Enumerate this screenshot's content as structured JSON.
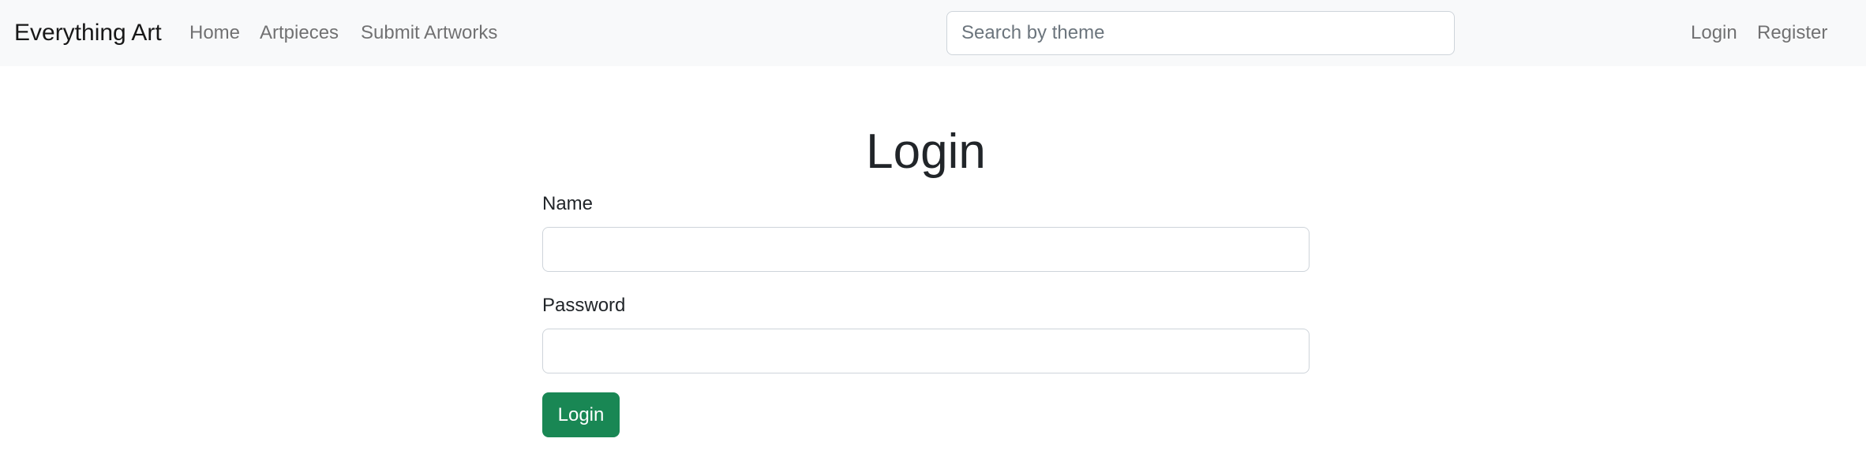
{
  "navbar": {
    "brand": "Everything Art",
    "links": [
      {
        "label": "Home"
      },
      {
        "label": "Artpieces"
      },
      {
        "label": "Submit Artworks"
      }
    ],
    "search": {
      "placeholder": "Search by theme",
      "value": ""
    },
    "auth_links": [
      {
        "label": "Login"
      },
      {
        "label": "Register"
      }
    ]
  },
  "main": {
    "title": "Login",
    "fields": [
      {
        "label": "Name",
        "value": ""
      },
      {
        "label": "Password",
        "value": ""
      }
    ],
    "submit_label": "Login"
  },
  "colors": {
    "navbar_bg": "#f8f9fa",
    "primary_button": "#198754"
  }
}
